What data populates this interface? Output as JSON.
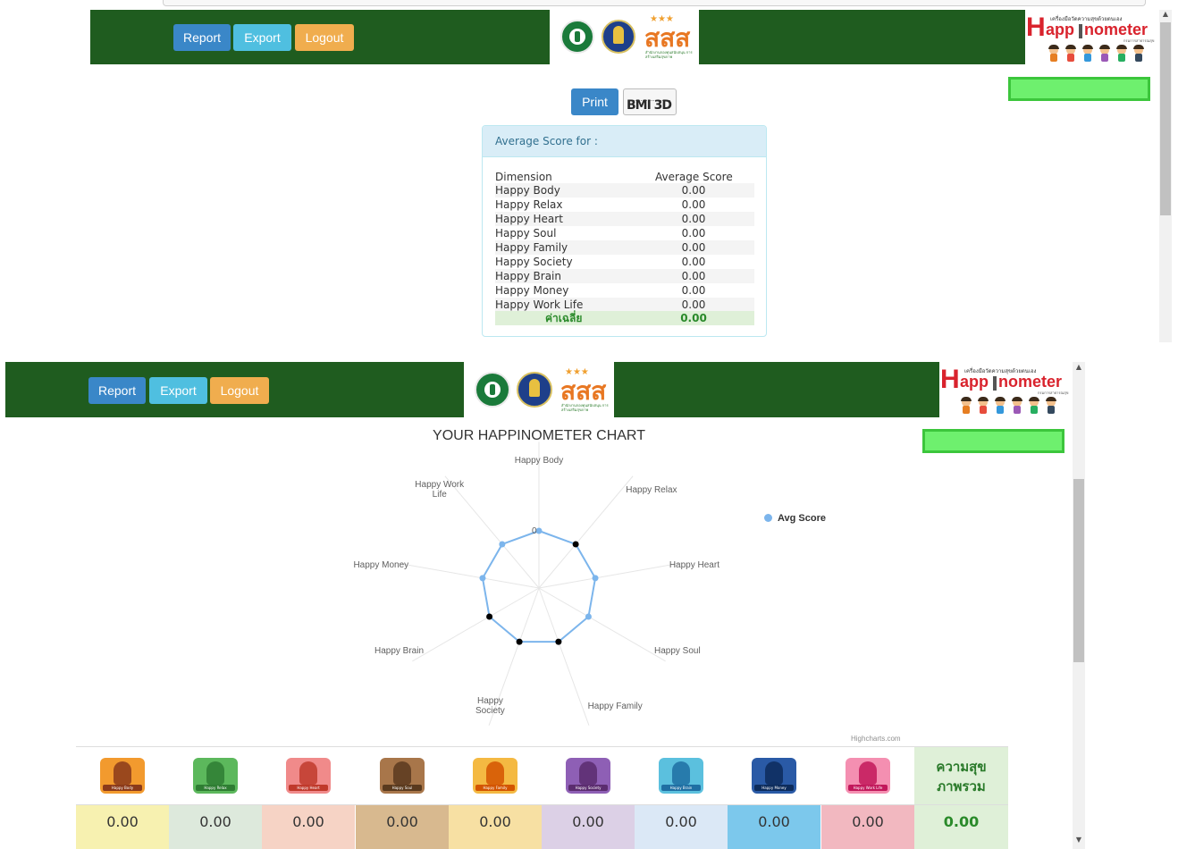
{
  "nav": {
    "report": "Report",
    "export": "Export",
    "logout": "Logout"
  },
  "logo": {
    "sss_text": "สสส",
    "sss_sub": "สำนักงานกองทุนสนับสนุน การสร้างเสริมสุขภาพ",
    "happ_small": "เครื่องมือวัดความสุขด้วยตนเอง",
    "happ_H": "H",
    "happ_word": "app",
    "happ_word2": "nometer",
    "happ_sub": "กรมการสาธารณสุข"
  },
  "report": {
    "print": "Print",
    "bmi": "BMI 3D",
    "panel_title": "Average Score for :",
    "col_dimension": "Dimension",
    "col_average": "Average Score",
    "rows": [
      {
        "dim": "Happy Body",
        "val": "0.00"
      },
      {
        "dim": "Happy Relax",
        "val": "0.00"
      },
      {
        "dim": "Happy Heart",
        "val": "0.00"
      },
      {
        "dim": "Happy Soul",
        "val": "0.00"
      },
      {
        "dim": "Happy Family",
        "val": "0.00"
      },
      {
        "dim": "Happy Society",
        "val": "0.00"
      },
      {
        "dim": "Happy Brain",
        "val": "0.00"
      },
      {
        "dim": "Happy Money",
        "val": "0.00"
      },
      {
        "dim": "Happy Work Life",
        "val": "0.00"
      }
    ],
    "avg_label": "ค่าเฉลี่ย",
    "avg_value": "0.00"
  },
  "chart_data": {
    "type": "radar",
    "title": "YOUR HAPPINOMETER CHART",
    "categories": [
      "Happy Body",
      "Happy Relax",
      "Happy Heart",
      "Happy Soul",
      "Happy Family",
      "Happy Society",
      "Happy Brain",
      "Happy Money",
      "Happy Work Life"
    ],
    "series": [
      {
        "name": "Avg Score",
        "values": [
          0,
          0,
          0,
          0,
          0,
          0,
          0,
          0,
          0
        ]
      }
    ],
    "axis_tick_label": "0",
    "legend_position": "right",
    "credit": "Highcharts.com",
    "series_color": "#7cb5ec"
  },
  "summary": {
    "overall_line1": "ความสุข",
    "overall_line2": "ภาพรวม",
    "dims": [
      {
        "name": "Happy Body",
        "icon": "happy-body-icon",
        "score": "0.00",
        "bg": "#f7f1b0",
        "icon_bg": "#f29a2e",
        "fig": "#8b3a1a"
      },
      {
        "name": "Happy Relax",
        "icon": "happy-relax-icon",
        "score": "0.00",
        "bg": "#dde9dc",
        "icon_bg": "#5cb85c",
        "fig": "#2e7d32"
      },
      {
        "name": "Happy Heart",
        "icon": "happy-heart-icon",
        "score": "0.00",
        "bg": "#f6d3c5",
        "icon_bg": "#f08a8a",
        "fig": "#c0392b"
      },
      {
        "name": "Happy Soul",
        "icon": "happy-soul-icon",
        "score": "0.00",
        "bg": "#d8b98f",
        "icon_bg": "#a8764a",
        "fig": "#5a3a1e"
      },
      {
        "name": "Happy Family",
        "icon": "happy-family-icon",
        "score": "0.00",
        "bg": "#f7e0a3",
        "icon_bg": "#f4b942",
        "fig": "#d35400"
      },
      {
        "name": "Happy Society",
        "icon": "happy-society-icon",
        "score": "0.00",
        "bg": "#dcd0e6",
        "icon_bg": "#8e5fb5",
        "fig": "#5b2c6f"
      },
      {
        "name": "Happy Brain",
        "icon": "happy-brain-icon",
        "score": "0.00",
        "bg": "#dbe8f6",
        "icon_bg": "#5bc0de",
        "fig": "#1f6fa3"
      },
      {
        "name": "Happy Money",
        "icon": "happy-money-icon",
        "score": "0.00",
        "bg": "#7cc8ec",
        "icon_bg": "#2a5aa6",
        "fig": "#0d2c5c"
      },
      {
        "name": "Happy Work Life",
        "icon": "happy-work-life-icon",
        "score": "0.00",
        "bg": "#f2b8c0",
        "icon_bg": "#f48fb1",
        "fig": "#c2185b"
      }
    ],
    "overall_score": "0.00"
  }
}
